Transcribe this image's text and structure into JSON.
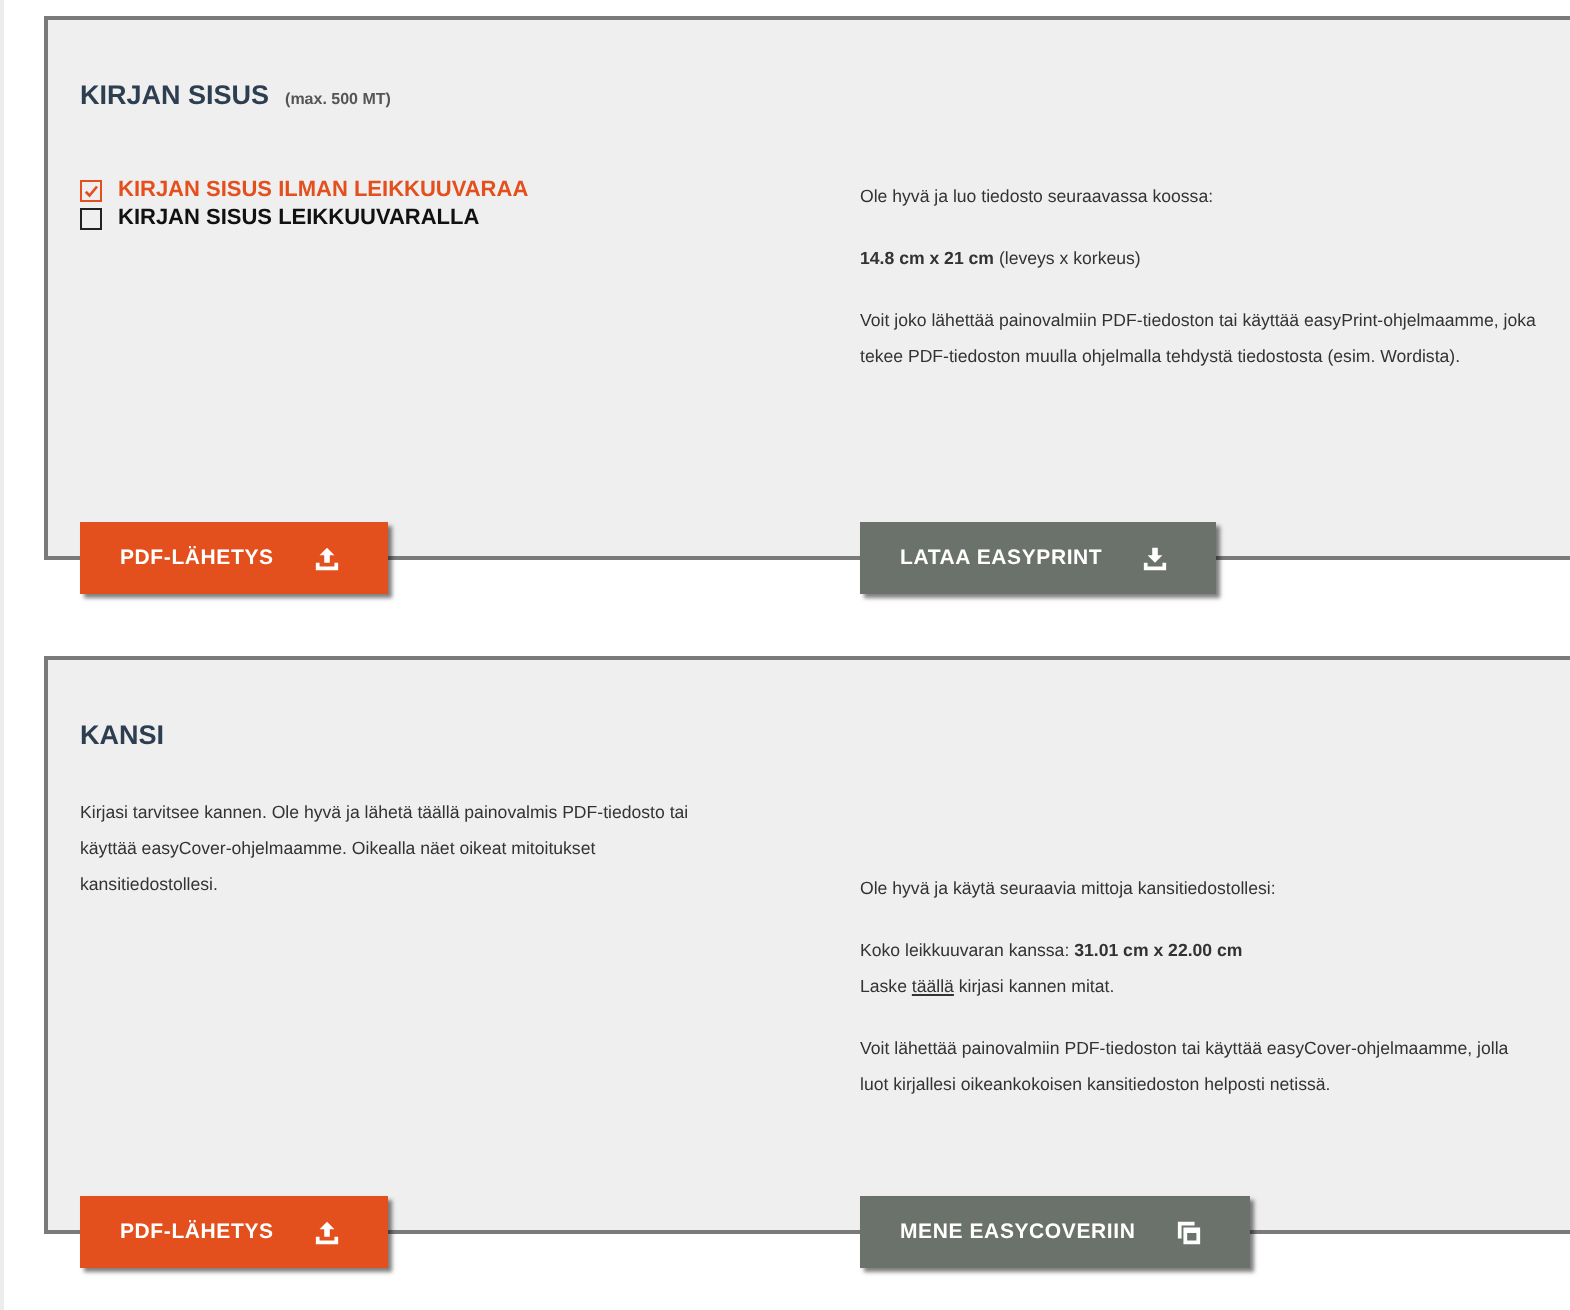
{
  "sections": [
    {
      "title": "KIRJAN SISUS",
      "title_note": "(max. 500 MT)",
      "options": [
        {
          "label": "KIRJAN SISUS ILMAN LEIKKUUVARAA",
          "checked": true
        },
        {
          "label": "KIRJAN SISUS LEIKKUUVARALLA",
          "checked": false
        }
      ],
      "right_paragraphs": [
        {
          "lines": [
            {
              "text": "Ole hyvä ja luo tiedosto seuraavassa koossa:"
            }
          ]
        },
        {
          "lines": [
            {
              "text": "**14.8 cm x 21 cm** (leveys x korkeus)"
            }
          ]
        },
        {
          "lines": [
            {
              "text": "Voit joko lähettää painovalmiin PDF-tiedoston tai käyttää easyPrint-ohjelmaamme, joka tekee PDF-tiedoston muulla ohjelmalla tehdystä tiedostosta (esim. Wordista)."
            }
          ]
        }
      ],
      "buttons": [
        {
          "label": "PDF-LÄHETYS",
          "kind": "upload"
        },
        {
          "label": "LATAA EASYPRINT",
          "kind": "download"
        }
      ]
    },
    {
      "title": "KANSI",
      "left_paragraphs": [
        {
          "lines": [
            {
              "text": "Kirjasi tarvitsee kannen. Ole hyvä ja lähetä täällä painovalmis PDF-tiedosto tai käyttää easyCover-ohjelmaamme. Oikealla näet oikeat mitoitukset kansitiedostollesi."
            }
          ]
        }
      ],
      "right_paragraphs": [
        {
          "lines": [
            {
              "text": "Ole hyvä ja käytä seuraavia mittoja kansitiedostollesi:"
            }
          ]
        },
        {
          "lines": [
            {
              "text": "Koko leikkuuvaran kanssa: **31.01 cm x 22.00 cm**"
            },
            {
              "text": "Laske ",
              "link": "täällä",
              "after": " kirjasi kannen mitat."
            }
          ]
        },
        {
          "lines": [
            {
              "text": "Voit lähettää painovalmiin PDF-tiedoston tai käyttää easyCover-ohjelmaamme, jolla luot kirjallesi oikeankokoisen kansitiedoston helposti netissä."
            }
          ]
        }
      ],
      "buttons": [
        {
          "label": "PDF-LÄHETYS",
          "kind": "upload"
        },
        {
          "label": "MENE EASYCOVERIIN",
          "kind": "copy"
        }
      ]
    }
  ]
}
